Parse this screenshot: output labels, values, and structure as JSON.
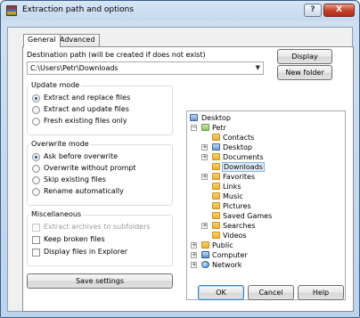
{
  "window": {
    "title": "Extraction path and options",
    "help_glyph": "?",
    "close_glyph": "X"
  },
  "tabs": [
    {
      "label": "General",
      "active": true
    },
    {
      "label": "Advanced",
      "active": false
    }
  ],
  "destination": {
    "label": "Destination path (will be created if does not exist)",
    "value": "C:\\Users\\Petr\\Downloads",
    "dropdown_glyph": "▼",
    "display_button": "Display",
    "new_folder_button": "New folder"
  },
  "update_mode": {
    "title": "Update mode",
    "options": [
      {
        "label": "Extract and replace files",
        "selected": true
      },
      {
        "label": "Extract and update files",
        "selected": false
      },
      {
        "label": "Fresh existing files only",
        "selected": false
      }
    ]
  },
  "overwrite_mode": {
    "title": "Overwrite mode",
    "options": [
      {
        "label": "Ask before overwrite",
        "selected": true
      },
      {
        "label": "Overwrite without prompt",
        "selected": false
      },
      {
        "label": "Skip existing files",
        "selected": false
      },
      {
        "label": "Rename automatically",
        "selected": false
      }
    ]
  },
  "miscellaneous": {
    "title": "Miscellaneous",
    "options": [
      {
        "label": "Extract archives to subfolders",
        "checked": false,
        "disabled": true
      },
      {
        "label": "Keep broken files",
        "checked": false,
        "disabled": false
      },
      {
        "label": "Display files in Explorer",
        "checked": false,
        "disabled": false
      }
    ]
  },
  "save_settings_button": "Save settings",
  "tree": {
    "nodes": [
      {
        "label": "Desktop",
        "icon": "desktop-icon"
      },
      {
        "label": "Petr",
        "icon": "user-folder-icon",
        "expander": "−"
      },
      {
        "label": "Contacts",
        "icon": "folder-icon"
      },
      {
        "label": "Desktop",
        "icon": "folder-icon",
        "expander": "+"
      },
      {
        "label": "Documents",
        "icon": "folder-icon",
        "expander": "+"
      },
      {
        "label": "Downloads",
        "icon": "folder-icon",
        "selected": true
      },
      {
        "label": "Favorites",
        "icon": "folder-icon",
        "expander": "+"
      },
      {
        "label": "Links",
        "icon": "folder-icon"
      },
      {
        "label": "Music",
        "icon": "folder-icon"
      },
      {
        "label": "Pictures",
        "icon": "folder-icon"
      },
      {
        "label": "Saved Games",
        "icon": "folder-icon"
      },
      {
        "label": "Searches",
        "icon": "folder-icon",
        "expander": "+"
      },
      {
        "label": "Videos",
        "icon": "folder-icon"
      },
      {
        "label": "Public",
        "icon": "folder-icon",
        "expander": "+"
      },
      {
        "label": "Computer",
        "icon": "computer-icon",
        "expander": "+"
      },
      {
        "label": "Network",
        "icon": "network-icon",
        "expander": "+"
      }
    ]
  },
  "footer": {
    "ok": "OK",
    "cancel": "Cancel",
    "help": "Help"
  },
  "colors": {
    "selection_fill": "#e0effc",
    "selection_border": "#84acdd",
    "window_frame": "#bcd3ec",
    "close_button": "#c5442c"
  }
}
